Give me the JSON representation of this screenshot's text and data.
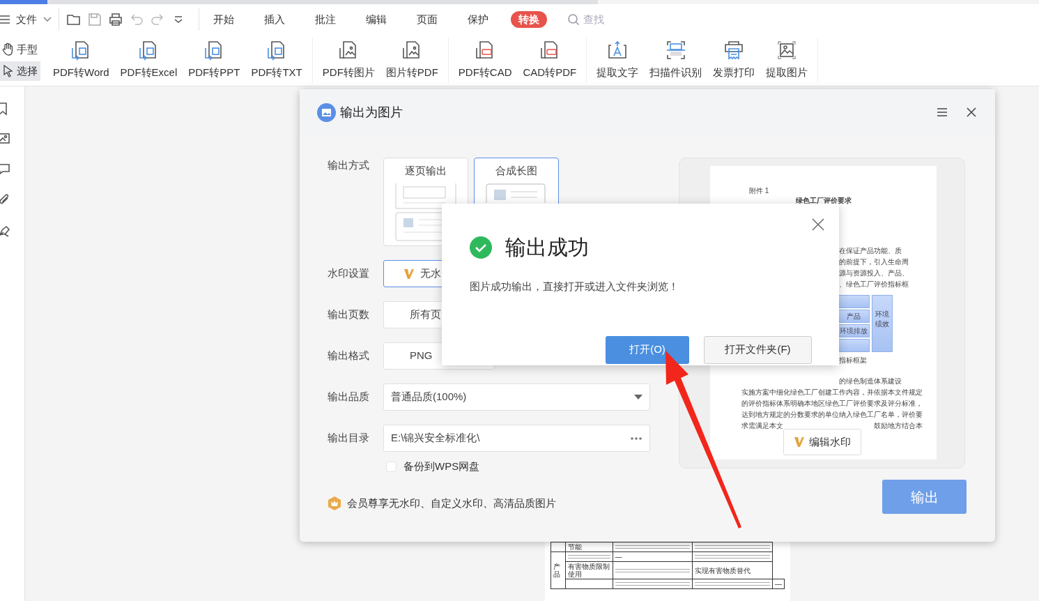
{
  "menu_bar": {
    "file_menu": "文件",
    "tabs": [
      {
        "label": "开始",
        "selected": false
      },
      {
        "label": "插入",
        "selected": false
      },
      {
        "label": "批注",
        "selected": false
      },
      {
        "label": "编辑",
        "selected": false
      },
      {
        "label": "页面",
        "selected": false
      },
      {
        "label": "保护",
        "selected": false
      },
      {
        "label": "转换",
        "selected": true
      }
    ],
    "search": {
      "placeholder": "查找"
    }
  },
  "tools": [
    {
      "label": "手型",
      "kind": "hand",
      "selected": false
    },
    {
      "label": "选择",
      "kind": "pointer",
      "selected": true
    }
  ],
  "ribbon_groups": [
    [
      {
        "label": "PDF转Word",
        "kind": "convert"
      },
      {
        "label": "PDF转Excel",
        "kind": "convert"
      },
      {
        "label": "PDF转PPT",
        "kind": "convert"
      },
      {
        "label": "PDF转TXT",
        "kind": "convert"
      }
    ],
    [
      {
        "label": "PDF转图片",
        "kind": "image_file"
      },
      {
        "label": "图片转PDF",
        "kind": "image_file"
      }
    ],
    [
      {
        "label": "PDF转CAD",
        "kind": "cad"
      },
      {
        "label": "CAD转PDF",
        "kind": "cad"
      }
    ],
    [
      {
        "label": "提取文字",
        "kind": "extract_text"
      },
      {
        "label": "扫描件识别",
        "kind": "scan"
      },
      {
        "label": "发票打印",
        "kind": "invoice"
      },
      {
        "label": "提取图片",
        "kind": "extract_image"
      }
    ]
  ],
  "background_table": {
    "group": "产品",
    "rows": [
      {
        "item": "节能"
      },
      {
        "standard": "—"
      },
      {
        "item": "有害物质限制使用",
        "target": "实现有害物质替代"
      },
      {
        "target": "—"
      }
    ]
  },
  "export_dialog": {
    "title": "输出为图片",
    "output_mode": {
      "label": "输出方式",
      "options": [
        {
          "label": "逐页输出",
          "kind": "pages",
          "selected": false
        },
        {
          "label": "合成长图",
          "kind": "long",
          "selected": true
        }
      ]
    },
    "fields": [
      {
        "label": "水印设置",
        "kind": "watermark",
        "value": "无水"
      },
      {
        "label": "输出页数",
        "kind": "plain",
        "value": "所有页"
      },
      {
        "label": "输出格式",
        "kind": "plain",
        "value": "PNG"
      },
      {
        "label": "输出品质",
        "kind": "select",
        "value": "普通品质(100%)"
      },
      {
        "label": "输出目录",
        "kind": "path",
        "value": "E:\\锦兴安全标准化\\"
      }
    ],
    "backup": {
      "label": "备份到WPS网盘",
      "checked": false
    },
    "member_note": "会员尊享无水印、自定义水印、高清品质图片",
    "preview": {
      "attachment": "附件 1",
      "heading": "绿色工厂评价要求",
      "upper_lines": [
        "在保证产品功能、质",
        "的前提下，引入生命周",
        "源与资源投入、产品、",
        "、绿色工厂评价指标框"
      ],
      "diagram": {
        "boxes": [
          "产品",
          "环境排放"
        ],
        "side_box": [
          "环境",
          "绩效"
        ],
        "caption": "指标框架"
      },
      "lower_lines": [
        "的绿色制造体系建设",
        "实施方案中细化绿色工厂创建工作内容，并依据本文件规定",
        "的评价指标体系明确本地区绿色工厂评价要求及评分标准，",
        "达到地方规定的分数要求的单位纳入绿色工厂名单，评价要"
      ],
      "last_line": [
        "求需满足本文",
        "鼓励地方结合本"
      ]
    },
    "edit_watermark": "编辑水印",
    "export_button": "输出"
  },
  "success_dialog": {
    "title": "输出成功",
    "message": "图片成功输出，直接打开或进入文件夹浏览！",
    "buttons": [
      {
        "label": "打开(O)",
        "kind": "primary"
      },
      {
        "label": "打开文件夹(F)",
        "kind": "secondary"
      }
    ]
  }
}
